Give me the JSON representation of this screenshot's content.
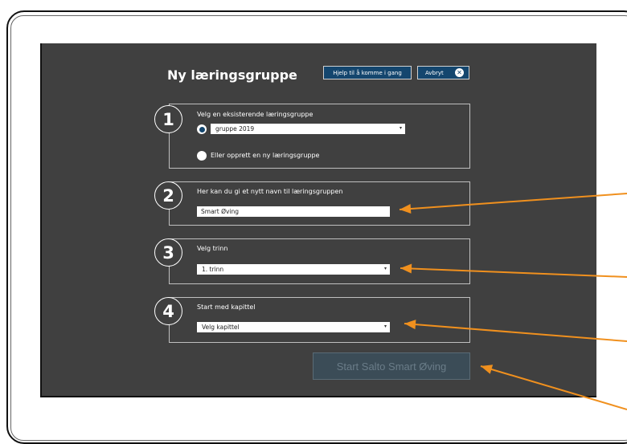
{
  "header": {
    "title": "Ny læringsgruppe",
    "help_button": "Hjelp til å komme i gang",
    "cancel_button": "Avbryt",
    "close_symbol": "✕"
  },
  "steps": [
    {
      "number": "1",
      "label": "Velg en eksisterende læringsgruppe",
      "select_value": "gruppe 2019",
      "alt_option": "Eller opprett en ny læringsgruppe"
    },
    {
      "number": "2",
      "label": "Her kan du gi et nytt navn til læringsgruppen",
      "input_value": "Smart Øving"
    },
    {
      "number": "3",
      "label": "Velg trinn",
      "select_value": "1. trinn"
    },
    {
      "number": "4",
      "label": "Start med kapittel",
      "select_value": "Velg kapittel"
    }
  ],
  "start_button": "Start Salto Smart Øving",
  "colors": {
    "panel": "#404040",
    "button": "#14466e",
    "arrow": "#f0901e",
    "start_button_disabled": "#3b4c57"
  }
}
